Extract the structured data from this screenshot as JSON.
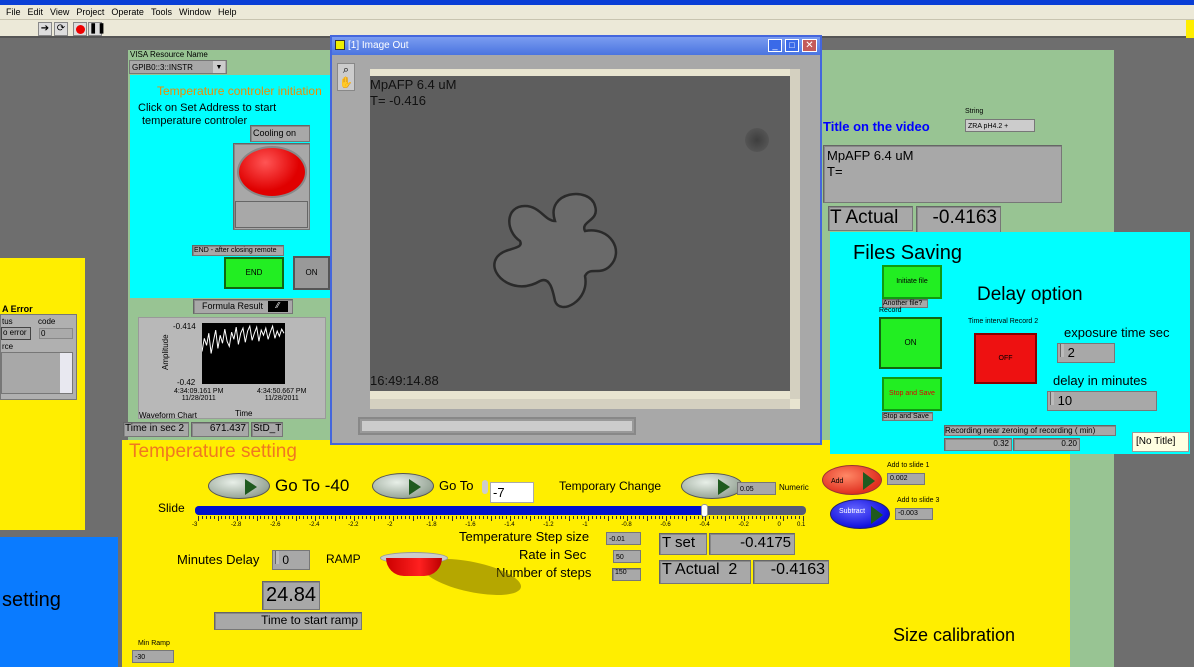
{
  "menu": [
    "File",
    "Edit",
    "View",
    "Project",
    "Operate",
    "Tools",
    "Window",
    "Help"
  ],
  "toolbar": {
    "icons": [
      "run-arrow-icon",
      "run-continuously-icon",
      "abort-icon",
      "pause-icon"
    ]
  },
  "visa": {
    "label": "VISA Resource Name",
    "value": "GPIB0::3::INSTR"
  },
  "tc": {
    "title": "Temperature controler initiation",
    "instructions_line1": "Click on Set Address to start",
    "instructions_line2": "temperature controler",
    "cooling_label": "Cooling on",
    "end_label": "END - after closing remote",
    "end_button": "END",
    "on_button": "ON"
  },
  "error": {
    "title": "A Error",
    "status_label": "tus",
    "code_label": "code",
    "status_value": "o error",
    "code_value": "0",
    "source_label": "rce"
  },
  "left_blue": {
    "text": "setting"
  },
  "formula": {
    "label": "Formula Result"
  },
  "waveform": {
    "name": "Waveform Chart",
    "ylabel": "Amplitude",
    "xlabel": "Time",
    "ymax_label": "-0.414",
    "ymin_label": "-0.42",
    "x_start": "4:34:09.161 PM",
    "x_start_date": "11/28/2011",
    "x_end": "4:34:50.667 PM",
    "x_end_date": "11/28/2011",
    "ylim": [
      -0.42,
      -0.414
    ],
    "values": [
      -0.4168,
      -0.4155,
      -0.4162,
      -0.415,
      -0.417,
      -0.4158,
      -0.4147,
      -0.4165,
      -0.4152,
      -0.416,
      -0.4146,
      -0.4158,
      -0.4163,
      -0.4149,
      -0.4156,
      -0.4144,
      -0.4161,
      -0.415,
      -0.4145,
      -0.4159,
      -0.4148,
      -0.4143,
      -0.4157,
      -0.415,
      -0.4144,
      -0.4158,
      -0.4147,
      -0.4152,
      -0.4145,
      -0.4156,
      -0.4149,
      -0.4143,
      -0.4155,
      -0.4148,
      -0.4153,
      -0.4146,
      -0.415
    ]
  },
  "time_sec": {
    "label": "Time in sec 2",
    "value": "671.437",
    "std_label": "StD_T"
  },
  "image_window": {
    "title": "[1] Image Out",
    "overlay_line1": "MpAFP 6.4 uM",
    "overlay_line2": "T= -0.416",
    "timestamp": "16:49:14.88"
  },
  "title_video": {
    "label": "Title on the video",
    "string_label": "String",
    "string_value": "ZRA pH4.2 +",
    "text_line1": "MpAFP 6.4 uM",
    "text_line2": "T="
  },
  "t_actual": {
    "label": "T Actual",
    "value": "-0.4163"
  },
  "files": {
    "title": "Files Saving",
    "initiate": "Initiate file",
    "another": "Another file?",
    "record_label": "Record",
    "record_on": "ON",
    "stop_save": "Stop and Save",
    "stop_save_label": "Stop and Save",
    "delay_title": "Delay option",
    "interval_label": "Time interval Record 2",
    "interval_off": "OFF",
    "exposure_label": "exposure time  sec",
    "exposure_value": "2",
    "delay_label": "delay in minutes",
    "delay_value": "10",
    "recording_label": "Recording near zeroing of recording ( min)",
    "rec_val1": "0.32",
    "rec_val2": "0.20",
    "tooltip": "[No Title]"
  },
  "temp": {
    "title": "Temperature setting",
    "goto40": "Go To -40",
    "goto": "Go To",
    "goto_value": "-7",
    "temporary": "Temporary Change",
    "numeric_value": "0.05",
    "numeric_label": "Numeric",
    "add": "Add",
    "add_label": "Add to slide 1",
    "add_value": "0.002",
    "subtract": "Subtract",
    "sub_label": "Add to slide 3",
    "sub_value": "-0.003",
    "slide_label": "Slide",
    "slide_value": -0.4175,
    "slide_range": [
      -3,
      0.1
    ],
    "ticks": [
      "-3",
      "-2.8",
      "-2.6",
      "-2.4",
      "-2.2",
      "-2",
      "-1.8",
      "-1.6",
      "-1.4",
      "-1.2",
      "-1",
      "-0.8",
      "-0.6",
      "-0.4",
      "-0.2",
      "0",
      "0.1"
    ],
    "step_label": "Temperature Step size",
    "step_value": "-0.01",
    "rate_label": "Rate in Sec",
    "rate_value": "50",
    "nsteps_label": "Number of steps",
    "nsteps_value": "150",
    "tset_label": "T set",
    "tset_value": "-0.4175",
    "tact2_label": "T Actual  2",
    "tact2_value": "-0.4163",
    "minutes_label": "Minutes Delay",
    "minutes_value": "0",
    "ramp_label": "RAMP",
    "time_value": "24.84",
    "time_label": "Time to start ramp",
    "minramp_label": "Min Ramp",
    "minramp_value": "-30",
    "size_cal": "Size calibration"
  },
  "colors": {
    "cyan": "#00ffff",
    "yellow": "#ffee00",
    "green_panel": "#98c493",
    "button_green": "#22ee22",
    "button_red": "#ee1111",
    "blue_panel": "#0a7bff"
  }
}
